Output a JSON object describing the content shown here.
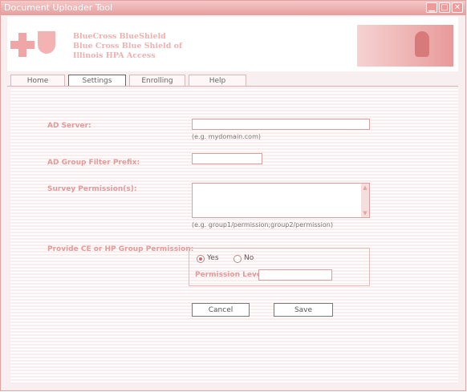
{
  "window": {
    "title": "Document Uploader Tool",
    "controls": [
      "minimize",
      "maximize",
      "close"
    ]
  },
  "header": {
    "brand_line1": "BlueCross BlueShield",
    "brand_line2": "Blue Cross Blue Shield of",
    "brand_line3": "Illinois HPA Access"
  },
  "tabs": [
    {
      "label": "Home"
    },
    {
      "label": "Settings"
    },
    {
      "label": "Enrolling"
    },
    {
      "label": "Help"
    }
  ],
  "form": {
    "ad_server": {
      "label": "AD Server:",
      "value": "",
      "hint": "(e.g. mydomain.com)"
    },
    "ad_group_filter": {
      "label": "AD Group Filter Prefix:",
      "value": ""
    },
    "survey_permissions": {
      "label": "Survey Permission(s):",
      "value": "",
      "hint": "(e.g. group1/permission;group2/permission)"
    },
    "provide_permission": {
      "label": "Provide CE or HP Group Permission:",
      "options": [
        {
          "label": "Yes",
          "selected": true
        },
        {
          "label": "No",
          "selected": false
        }
      ],
      "permission_level_label": "Permission Level:",
      "permission_level_value": ""
    },
    "cancel_label": "Cancel",
    "save_label": "Save"
  }
}
